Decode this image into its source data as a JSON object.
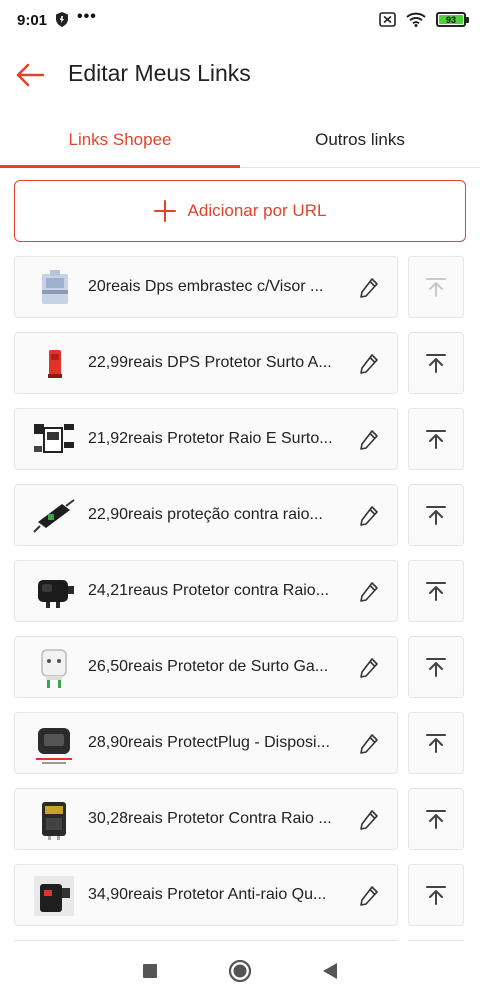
{
  "status": {
    "time": "9:01",
    "dots": "•••",
    "battery": "93"
  },
  "header": {
    "title": "Editar Meus Links",
    "back_icon": "arrow-left-icon"
  },
  "tabs": [
    {
      "label": "Links Shopee",
      "active": true
    },
    {
      "label": "Outros links",
      "active": false
    }
  ],
  "add_button": {
    "label": "Adicionar por URL",
    "icon": "plus-icon"
  },
  "links": [
    {
      "title": "20reais Dps embrastec c/Visor ..."
    },
    {
      "title": "22,99reais DPS Protetor Surto A..."
    },
    {
      "title": "21,92reais Protetor Raio E Surto..."
    },
    {
      "title": "22,90reais proteção contra raio..."
    },
    {
      "title": "24,21reaus Protetor contra Raio..."
    },
    {
      "title": "26,50reais Protetor de Surto Ga..."
    },
    {
      "title": "28,90reais ProtectPlug - Disposi..."
    },
    {
      "title": "30,28reais Protetor Contra Raio ..."
    },
    {
      "title": "34,90reais Protetor Anti-raio Qu..."
    }
  ],
  "colors": {
    "accent": "#e0442a",
    "border": "#e6e6e6",
    "card_bg": "#fafafa"
  }
}
